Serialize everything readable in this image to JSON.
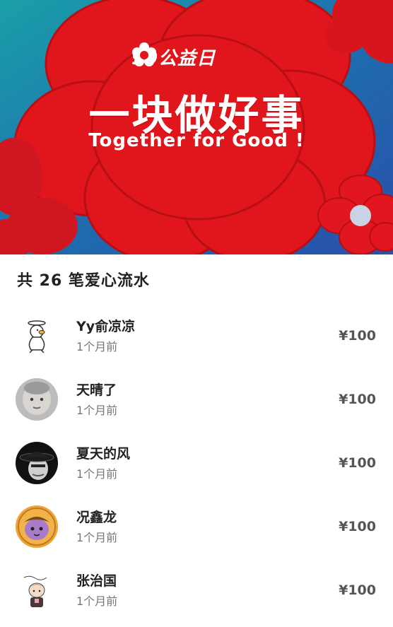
{
  "banner": {
    "brand": "99公益日",
    "headline": "一块做好事",
    "slogan": "Together for Good !",
    "colors": {
      "background": "#1d6fa8",
      "flower": "#e0161c",
      "text": "#ffffff"
    }
  },
  "donations": {
    "title": "共 26 笔爱心流水",
    "items": [
      {
        "name": "Yy俞凉凉⁣",
        "time": "1个月前",
        "amount": "¥100",
        "avatar": "duck-cartoon"
      },
      {
        "name": "天晴了",
        "time": "1个月前",
        "amount": "¥100",
        "avatar": "baby-photo"
      },
      {
        "name": "夏天的风",
        "time": "1个月前",
        "amount": "¥100",
        "avatar": "man-hat-photo"
      },
      {
        "name": "况鑫龙",
        "time": "1个月前",
        "amount": "¥100",
        "avatar": "cartoon-face"
      },
      {
        "name": "张治国",
        "time": "1个月前",
        "amount": "¥100",
        "avatar": "chibi-character"
      }
    ]
  }
}
